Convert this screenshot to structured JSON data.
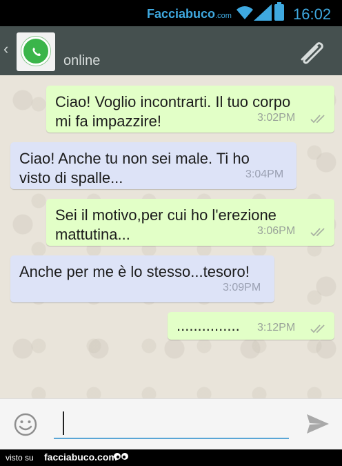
{
  "status_bar": {
    "watermark": "Facciabuco",
    "watermark_suffix": ".com",
    "time": "16:02"
  },
  "header": {
    "contact_status": "online",
    "avatar_icon": "whatsapp-logo-icon",
    "back_icon": "chevron-left-icon",
    "attach_icon": "paperclip-icon"
  },
  "messages": [
    {
      "direction": "outgoing",
      "text_lines": [
        "Ciao! Voglio incontrarti. Il tuo corpo",
        "mi fa impazzire!"
      ],
      "time": "3:02PM",
      "status": "delivered-double-check"
    },
    {
      "direction": "incoming",
      "text_lines": [
        "Ciao! Anche tu non sei male. Ti ho",
        "visto di spalle..."
      ],
      "time": "3:04PM"
    },
    {
      "direction": "outgoing",
      "text_lines": [
        "Sei il motivo,per cui ho l'erezione",
        "mattutina..."
      ],
      "time": "3:06PM",
      "status": "delivered-double-check"
    },
    {
      "direction": "incoming",
      "text_lines": [
        "Anche per me è lo stesso...tesoro!"
      ],
      "time": "3:09PM"
    },
    {
      "direction": "outgoing",
      "text_lines": [
        "..............."
      ],
      "time": "3:12PM",
      "status": "delivered-double-check"
    }
  ],
  "composer": {
    "value": "",
    "emoji_icon": "smiley-icon",
    "send_icon": "send-arrow-icon"
  },
  "footer": {
    "prefix": "visto su",
    "site": "facciabuco.com"
  },
  "colors": {
    "outgoing_bubble": "#e2ffc7",
    "incoming_bubble": "#dde3f7",
    "action_bar": "#45504f",
    "status_accent": "#3fa9e0"
  }
}
